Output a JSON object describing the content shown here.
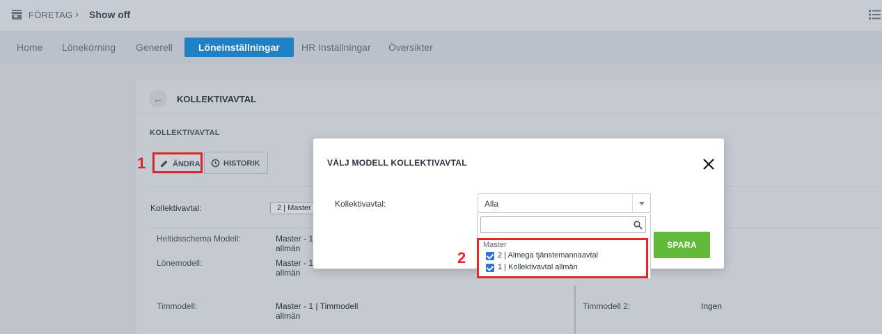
{
  "header": {
    "company_label": "FÖRETAG",
    "separator": "›",
    "current": "Show off"
  },
  "nav": {
    "items": [
      {
        "label": "Home"
      },
      {
        "label": "Lönekörning"
      },
      {
        "label": "Generell"
      },
      {
        "label": "Löneinställningar",
        "active": true
      },
      {
        "label": "HR Inställningar"
      },
      {
        "label": "Översikter"
      }
    ]
  },
  "card": {
    "title": "KOLLEKTIVAVTAL",
    "back_glyph": "←",
    "section_title": "KOLLEKTIVAVTAL",
    "edit_button": "ÄNDRA",
    "history_button": "HISTORIK",
    "kollektivavtal_label": "Kollektivavtal:",
    "kollektivavtal_value": "2 | Master",
    "rows": [
      {
        "label": "Heltidsschema Modell:",
        "value": "Master - 1",
        "value2": "allmän"
      },
      {
        "label": "Lönemodell:",
        "value": "Master - 1",
        "value2": "allmän"
      },
      {
        "label": "Timmodell:",
        "value": "Master - 1 | Timmodell",
        "value2": "allmän"
      }
    ],
    "right_rows": [
      {
        "label": "Timmodell 2:",
        "value": "Ingen"
      }
    ]
  },
  "markers": {
    "one": "1",
    "two": "2"
  },
  "modal": {
    "title": "VÄLJ MODELL KOLLEKTIVAVTAL",
    "field_label": "Kollektivavtal:",
    "select_value": "Alla",
    "save_button": "SPARA",
    "dropdown": {
      "search_value": "",
      "group_label": "Master",
      "options": [
        {
          "label": "2 | Almega tjänstemannaavtal",
          "checked": true
        },
        {
          "label": "1 | Kollektivavtal allmän",
          "checked": true
        }
      ]
    }
  },
  "colors": {
    "accent": "#1f86cb",
    "save_green": "#62b93a",
    "highlight_red": "#e3262b",
    "checkbox_blue": "#2f74d0"
  },
  "icons": [
    "store-icon",
    "list-icon",
    "back-arrow-icon",
    "pencil-icon",
    "history-icon",
    "close-icon",
    "chevron-down-icon",
    "search-icon",
    "checkbox-icon"
  ]
}
